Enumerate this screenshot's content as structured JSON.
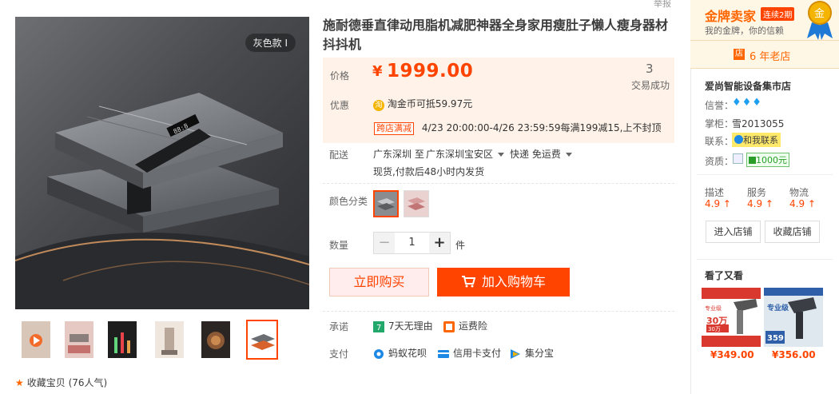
{
  "gallery": {
    "badge": "灰色款 I",
    "thumbnails": [
      "thumb-1",
      "thumb-2",
      "thumb-3",
      "thumb-4",
      "thumb-5",
      "thumb-6"
    ],
    "favorite_label": "收藏宝贝",
    "favorite_count": "(76人气)"
  },
  "top_tag": "举报",
  "product": {
    "title": "施耐德垂直律动甩脂机减肥神器全身家用瘦肚子懒人瘦身器材抖抖机",
    "price_label": "价格",
    "price_symbol": "¥",
    "price": "1999.00",
    "deals_count": "3",
    "deals_label": "交易成功",
    "promo_label": "优惠",
    "coin_text": "淘金币可抵",
    "coin_amount": "59.97元",
    "promo_tag": "跨店满减",
    "promo_text": "4/23 20:00:00-4/26 23:59:59每满199减15,上不封顶",
    "ship_label": "配送",
    "ship_from": "广东深圳 至",
    "ship_to": "广东深圳宝安区",
    "ship_method": "快递 免运费",
    "ship_note": "现货,付款后48小时内发货",
    "color_label": "颜色分类",
    "qty_label": "数量",
    "qty_value": "1",
    "qty_unit": "件",
    "buy_now": "立即购买",
    "add_cart": "加入购物车",
    "promise_label": "承诺",
    "promise_1": "7天无理由",
    "promise_2": "运费险",
    "pay_label": "支付",
    "pay_1": "蚂蚁花呗",
    "pay_2": "信用卡支付",
    "pay_3": "集分宝"
  },
  "shop": {
    "gold_title": "金牌卖家",
    "gold_badge": "连续2期",
    "gold_sub": "我的金牌，你的信赖",
    "old_shop_icon": "店",
    "old_shop": "6 年老店",
    "name": "爱尚智能设备集市店",
    "credit_label": "信誉：",
    "keeper_label": "掌柜：",
    "keeper": "雪2013055",
    "contact_label": "联系：",
    "contact": "和我联系",
    "qual_label": "资质：",
    "qual_value": "1000元",
    "ratings": [
      {
        "label": "描述",
        "value": "4.9 ↑"
      },
      {
        "label": "服务",
        "value": "4.9 ↑"
      },
      {
        "label": "物流",
        "value": "4.9 ↑"
      }
    ],
    "enter_shop": "进入店铺",
    "fav_shop": "收藏店铺",
    "also_viewed": "看了又看",
    "rec_prices": [
      "¥349.00",
      "¥356.00"
    ],
    "rec_1_texts": {
      "a": "专业级",
      "b": "30万",
      "c": "30万"
    },
    "rec_2_texts": {
      "a": "专业级",
      "b": "359"
    }
  },
  "colors": {
    "accent": "#ff4400",
    "price_bg": "#fff2e8",
    "gold_bg": "#fff7e6"
  }
}
